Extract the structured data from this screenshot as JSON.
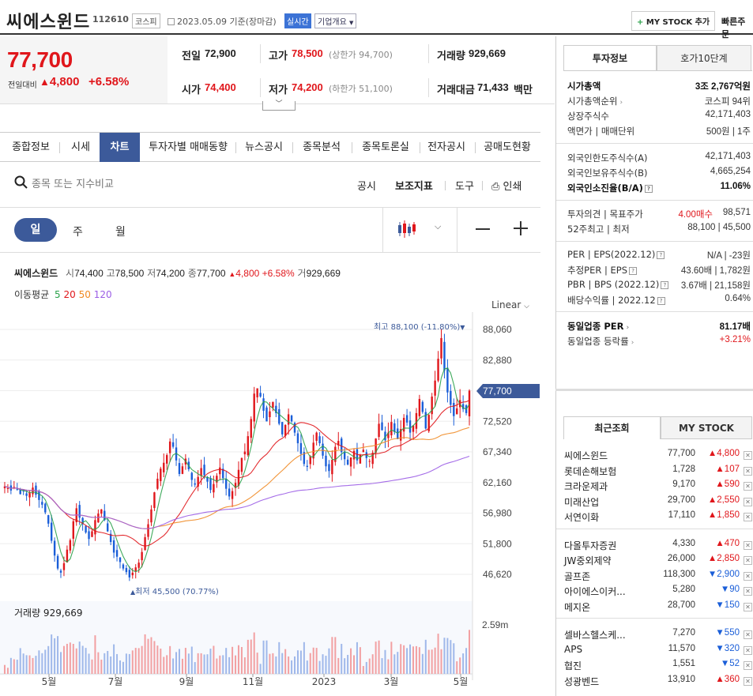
{
  "header": {
    "name": "씨에스윈드",
    "code": "112610",
    "market": "코스피",
    "date_info": "2023.05.09 기준(장마감)",
    "realtime": "실시간",
    "company_overview": "기업개요",
    "mystock_add": "MY STOCK 추가",
    "quick_order": "빠른주문"
  },
  "price": {
    "current": "77,700",
    "change_label": "전일대비",
    "change": "4,800",
    "change_pct": "+6.58%"
  },
  "quote": {
    "prev_close_label": "전일",
    "prev_close": "72,900",
    "high_label": "고가",
    "high": "78,500",
    "upper_limit": "(상한가 94,700)",
    "volume_label": "거래량",
    "volume": "929,669",
    "open_label": "시가",
    "open": "74,400",
    "low_label": "저가",
    "low": "74,200",
    "lower_limit": "(하한가 51,100)",
    "amount_label": "거래대금",
    "amount": "71,433",
    "amount_unit": "백만"
  },
  "tabs": [
    "종합정보",
    "시세",
    "차트",
    "투자자별 매매동향",
    "뉴스공시",
    "종목분석",
    "종목토론실",
    "전자공시",
    "공매도현황"
  ],
  "active_tab": "차트",
  "search": {
    "placeholder": "종목 또는 지수비교",
    "links": [
      "공시",
      "보조지표",
      "도구",
      "인쇄"
    ]
  },
  "periods": [
    "일",
    "주",
    "월"
  ],
  "chart_header": {
    "name": "씨에스윈드",
    "open_label": "시",
    "open": "74,400",
    "high_label": "고",
    "high": "78,500",
    "low_label": "저",
    "low": "74,200",
    "close_label": "종",
    "close": "77,700",
    "change": "4,800",
    "change_pct": "+6.58%",
    "volume_label": "거",
    "volume": "929,669",
    "ma_label": "이동평균",
    "ma": [
      {
        "period": "5",
        "color": "#2aa14a"
      },
      {
        "period": "20",
        "color": "#e0161b"
      },
      {
        "period": "50",
        "color": "#f08a24"
      },
      {
        "period": "120",
        "color": "#9b5de5"
      }
    ],
    "scale": "Linear"
  },
  "chart_data": {
    "type": "candlestick",
    "y_ticks": [
      "88,060",
      "82,880",
      "77,700",
      "72,520",
      "67,340",
      "62,160",
      "56,980",
      "51,800",
      "46,620"
    ],
    "ylim": [
      46620,
      88060
    ],
    "x_ticks": [
      "5월",
      "7월",
      "9월",
      "11월",
      "2023",
      "3월",
      "5월"
    ],
    "current_price_tag": "77,700",
    "max_label": "최고 88,100 (-11.80%)",
    "min_label": "최저 45,500 (70.77%)",
    "volume_label": "거래량 929,669",
    "volume_tick": "2.59m",
    "close_series": [
      61500,
      61200,
      60800,
      61400,
      61000,
      60200,
      60700,
      59900,
      60500,
      61300,
      60100,
      59200,
      58400,
      57100,
      55200,
      52300,
      49800,
      47600,
      46900,
      48500,
      50800,
      52400,
      55600,
      57800,
      56200,
      55100,
      53700,
      52600,
      53900,
      55800,
      56900,
      57600,
      55800,
      53900,
      52100,
      50300,
      49600,
      48700,
      47600,
      47000,
      46100,
      46900,
      47800,
      48600,
      50400,
      52900,
      55100,
      57600,
      60500,
      62800,
      64500,
      65500,
      66800,
      69100,
      68200,
      65900,
      63600,
      64900,
      66200,
      64400,
      62600,
      61800,
      63100,
      64600,
      63400,
      62300,
      60900,
      61900,
      63300,
      64700,
      62900,
      61100,
      59800,
      60700,
      62100,
      64300,
      66300,
      67400,
      70000,
      72900,
      77200,
      78100,
      76700,
      74300,
      72500,
      74200,
      75800,
      73900,
      72100,
      70300,
      71900,
      73700,
      72500,
      70600,
      68800,
      67000,
      65300,
      64800,
      66600,
      68900,
      70600,
      68800,
      66700,
      64900,
      64100,
      66000,
      68200,
      69200,
      67300,
      66100,
      65200,
      66400,
      67500,
      65900,
      66800,
      67700,
      66300,
      65800,
      67200,
      69600,
      72100,
      71000,
      69300,
      70600,
      72400,
      70700,
      69500,
      71200,
      73100,
      72300,
      70600,
      71800,
      73900,
      76300,
      74100,
      71300,
      73600,
      76700,
      79400,
      83100,
      86600,
      81100,
      77400,
      75300,
      73400,
      74700,
      76100,
      74600,
      73900,
      77700
    ]
  },
  "right_tabs": [
    "투자정보",
    "호가10단계"
  ],
  "invest_info": {
    "group1": [
      {
        "label": "시가총액",
        "value": "3조 2,767억원"
      },
      {
        "label": "시가총액순위",
        "value": "코스피 94위"
      },
      {
        "label": "상장주식수",
        "value": "42,171,403"
      },
      {
        "label": "액면가 | 매매단위",
        "value": "500원 | 1주"
      }
    ],
    "group2": [
      {
        "label": "외국인한도주식수(A)",
        "value": "42,171,403"
      },
      {
        "label": "외국인보유주식수(B)",
        "value": "4,665,254"
      },
      {
        "label": "외국인소진율(B/A)",
        "value": "11.06%"
      }
    ],
    "group3": [
      {
        "label": "투자의견 | 목표주가",
        "opinion": "4.00매수",
        "target": "98,571"
      },
      {
        "label": "52주최고 | 최저",
        "value": "88,100 | 45,500"
      }
    ],
    "group4": [
      {
        "label": "PER | EPS(2022.12)",
        "value": "N/A | -23원"
      },
      {
        "label": "추정PER | EPS",
        "value": "43.60배 | 1,782원"
      },
      {
        "label": "PBR | BPS (2022.12)",
        "value": "3.67배 | 21,158원"
      },
      {
        "label": "배당수익률 | 2022.12",
        "value": "0.64%"
      }
    ],
    "group5": [
      {
        "label": "동일업종 PER",
        "value": "81.17배"
      },
      {
        "label": "동일업종 등락률",
        "value": "+3.21%"
      }
    ]
  },
  "recent_tabs": [
    "최근조회",
    "MY STOCK"
  ],
  "recent": [
    [
      {
        "name": "씨에스윈드",
        "price": "77,700",
        "change": "4,800",
        "dir": "up"
      },
      {
        "name": "롯데손해보험",
        "price": "1,728",
        "change": "107",
        "dir": "up"
      },
      {
        "name": "크라운제과",
        "price": "9,170",
        "change": "590",
        "dir": "up"
      },
      {
        "name": "미래산업",
        "price": "29,700",
        "change": "2,550",
        "dir": "up"
      },
      {
        "name": "서연이화",
        "price": "17,110",
        "change": "1,850",
        "dir": "up"
      }
    ],
    [
      {
        "name": "다올투자증권",
        "price": "4,330",
        "change": "470",
        "dir": "up"
      },
      {
        "name": "JW중외제약",
        "price": "26,000",
        "change": "2,850",
        "dir": "up"
      },
      {
        "name": "골프존",
        "price": "118,300",
        "change": "2,900",
        "dir": "down"
      },
      {
        "name": "아이에스이커...",
        "price": "5,280",
        "change": "90",
        "dir": "down"
      },
      {
        "name": "메지온",
        "price": "28,700",
        "change": "150",
        "dir": "down"
      }
    ],
    [
      {
        "name": "셀바스헬스케...",
        "price": "7,270",
        "change": "550",
        "dir": "down"
      },
      {
        "name": "APS",
        "price": "11,570",
        "change": "320",
        "dir": "down"
      },
      {
        "name": "협진",
        "price": "1,551",
        "change": "52",
        "dir": "down"
      },
      {
        "name": "성광벤드",
        "price": "13,910",
        "change": "360",
        "dir": "up"
      }
    ]
  ]
}
